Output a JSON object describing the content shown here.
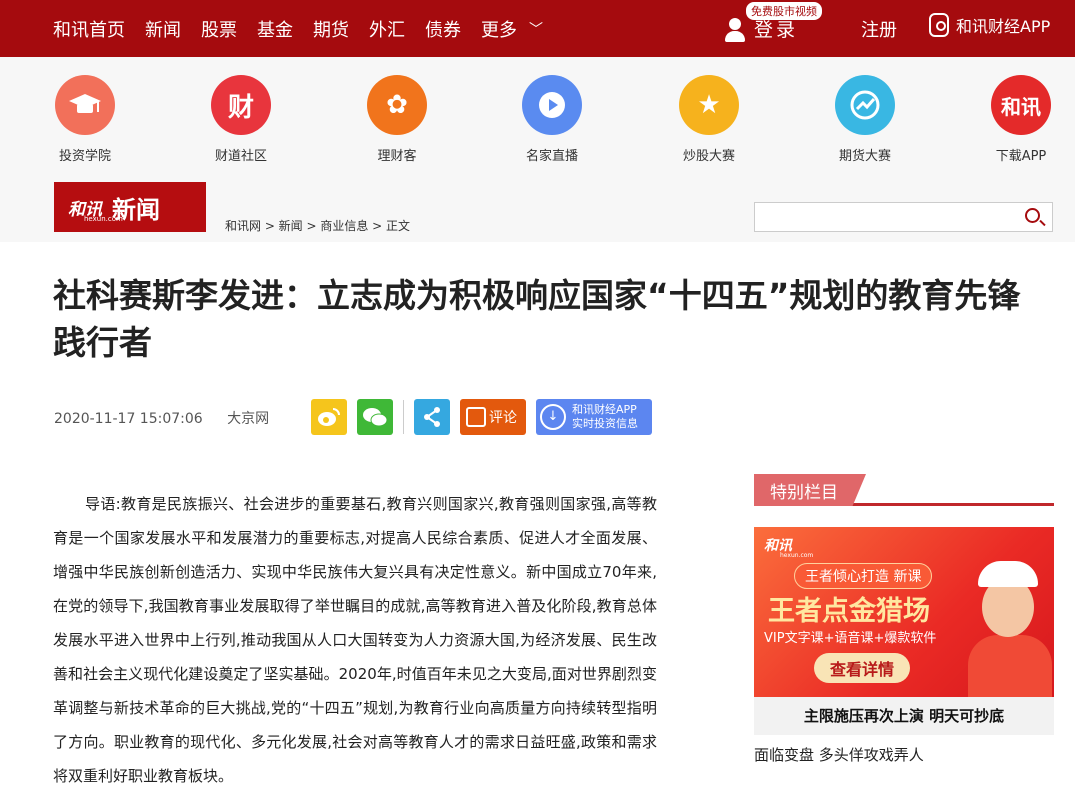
{
  "nav": {
    "items": [
      "和讯首页",
      "新闻",
      "股票",
      "基金",
      "期货",
      "外汇",
      "债券",
      "更多"
    ],
    "login_badge": "免费股市视频",
    "login": "登录",
    "register": "注册",
    "app": "和讯财经APP"
  },
  "icons": [
    {
      "label": "投资学院",
      "color": "#f2705a",
      "glyph": "graduation-cap-icon"
    },
    {
      "label": "财道社区",
      "color": "#e8353d",
      "glyph": "wealth-icon"
    },
    {
      "label": "理财客",
      "color": "#f1741c",
      "glyph": "flower-icon"
    },
    {
      "label": "名家直播",
      "color": "#5a8bf0",
      "glyph": "play-icon"
    },
    {
      "label": "炒股大赛",
      "color": "#f6b21d",
      "glyph": "star-icon"
    },
    {
      "label": "期货大赛",
      "color": "#39b7e3",
      "glyph": "chart-icon"
    },
    {
      "label": "下载APP",
      "color": "#e42a2a",
      "glyph": "hexun-logo-icon"
    }
  ],
  "logo": {
    "brand": "和讯",
    "site": "hexun.com",
    "section": "新闻"
  },
  "breadcrumb": "和讯网 > 新闻 > 商业信息 > 正文",
  "search": {
    "placeholder": "",
    "value": ""
  },
  "article": {
    "title": "社科赛斯李发进：立志成为积极响应国家“十四五”规划的教育先锋践行者",
    "date": "2020-11-17 15:07:06",
    "source": "大京网",
    "comment": "评论",
    "app_line1": "和讯财经APP",
    "app_line2": "实时投资信息",
    "body": "导语:教育是民族振兴、社会进步的重要基石,教育兴则国家兴,教育强则国家强,高等教育是一个国家发展水平和发展潜力的重要标志,对提高人民综合素质、促进人才全面发展、增强中华民族创新创造活力、实现中华民族伟大复兴具有决定性意义。新中国成立70年来,在党的领导下,我国教育事业发展取得了举世瞩目的成就,高等教育进入普及化阶段,教育总体发展水平进入世界中上行列,推动我国从人口大国转变为人力资源大国,为经济发展、民生改善和社会主义现代化建设奠定了坚实基础。2020年,时值百年未见之大变局,面对世界剧烈变革调整与新技术革命的巨大挑战,党的“十四五”规划,为教育行业向高质量方向持续转型指明了方向。职业教育的现代化、多元化发展,社会对高等教育人才的需求日益旺盛,政策和需求将双重利好职业教育板块。"
  },
  "sidebar": {
    "title": "特别栏目",
    "banner": {
      "brand": "和讯",
      "site": "hexun.com",
      "pill": "王者倾心打造 新课",
      "headline": "王者点金猎场",
      "sub": "VIP文字课+语音课+爆款软件",
      "cta": "查看详情"
    },
    "caption": "主限施压再次上演 明天可抄底",
    "link": "面临变盘 多头佯攻戏弄人"
  }
}
